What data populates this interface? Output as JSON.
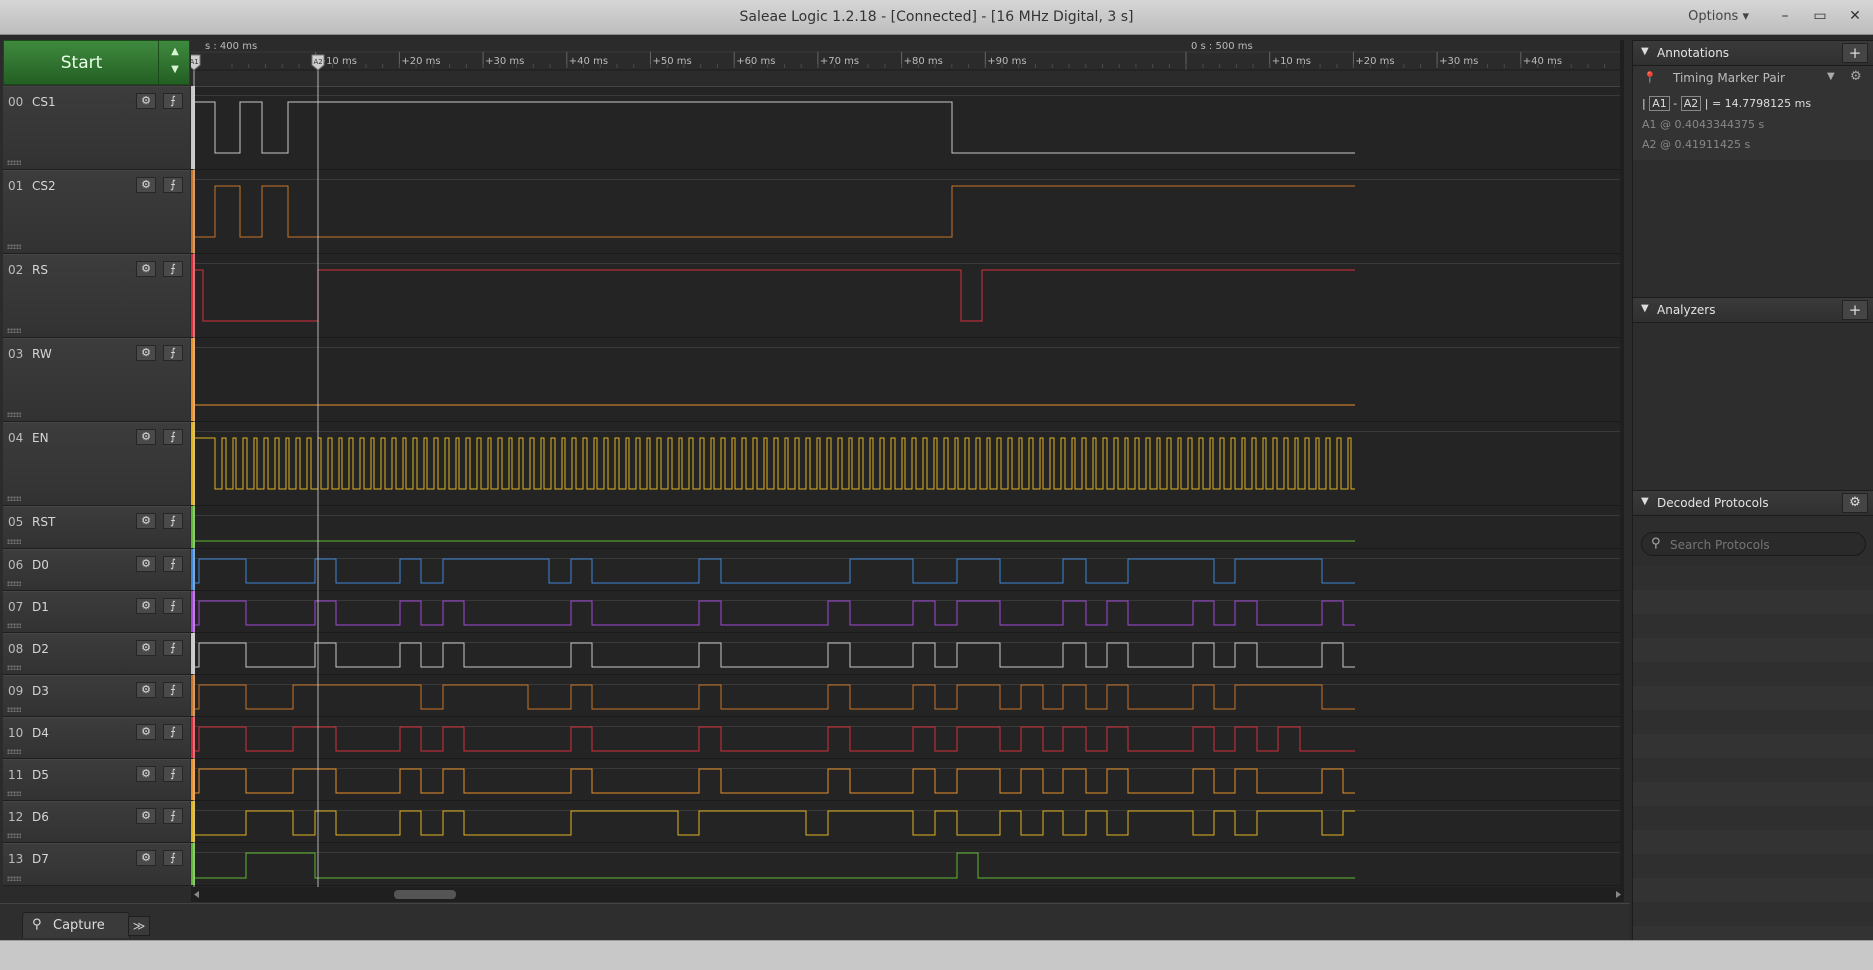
{
  "window": {
    "title": "Saleae Logic 1.2.18 - [Connected] - [16 MHz Digital, 3 s]",
    "options_label": "Options ▾",
    "minimize": "–",
    "maximize": "▭",
    "close": "✕"
  },
  "start_button": {
    "label": "Start"
  },
  "time_header": {
    "major_left": "s : 400 ms",
    "major_right": "0 s : 500 ms",
    "ticks_group1": [
      "+10 ms",
      "+20 ms",
      "+30 ms",
      "+40 ms",
      "+50 ms",
      "+60 ms",
      "+70 ms",
      "+80 ms",
      "+90 ms"
    ],
    "ticks_group2": [
      "+10 ms",
      "+20 ms",
      "+30 ms",
      "+40 ms"
    ],
    "marker_a1": "A1",
    "marker_a2": "A2"
  },
  "channels": [
    {
      "num": "00",
      "name": "CS1",
      "color": "#c8c8c8"
    },
    {
      "num": "01",
      "name": "CS2",
      "color": "#c8752a"
    },
    {
      "num": "02",
      "name": "RS",
      "color": "#d42f3a"
    },
    {
      "num": "03",
      "name": "RW",
      "color": "#e8902a"
    },
    {
      "num": "04",
      "name": "EN",
      "color": "#e0b21f"
    },
    {
      "num": "05",
      "name": "RST",
      "color": "#5fb833"
    },
    {
      "num": "06",
      "name": "D0",
      "color": "#3f86d6"
    },
    {
      "num": "07",
      "name": "D1",
      "color": "#a24ad6"
    },
    {
      "num": "08",
      "name": "D2",
      "color": "#c8c8c8"
    },
    {
      "num": "09",
      "name": "D3",
      "color": "#c8752a"
    },
    {
      "num": "10",
      "name": "D4",
      "color": "#d42f3a"
    },
    {
      "num": "11",
      "name": "D5",
      "color": "#e8902a"
    },
    {
      "num": "12",
      "name": "D6",
      "color": "#e0b21f"
    },
    {
      "num": "13",
      "name": "D7",
      "color": "#5fb833"
    }
  ],
  "bottom": {
    "capture_tab": "Capture",
    "more": "≫"
  },
  "annotations": {
    "header": "Annotations",
    "marker_pair": "Timing Marker Pair",
    "a1_label": "A1",
    "a2_label": "A2",
    "diff_value": "= 14.7798125 ms",
    "a1_line": "A1  @  0.4043344375 s",
    "a2_line": "A2  @  0.41911425 s"
  },
  "analyzers": {
    "header": "Analyzers"
  },
  "decoded_protocols": {
    "header": "Decoded Protocols",
    "search_placeholder": "Search Protocols"
  }
}
